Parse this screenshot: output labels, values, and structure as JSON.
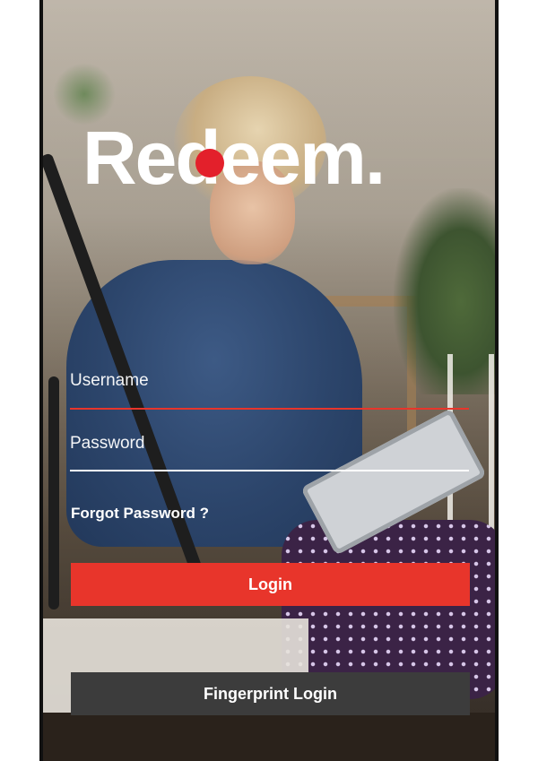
{
  "brand": {
    "logo_part1": "Re",
    "logo_part2": "deem.",
    "accent_color": "#e8352b"
  },
  "form": {
    "username_placeholder": "Username",
    "password_placeholder": "Password",
    "username_underline_color": "#e8352b",
    "password_underline_color": "#ffffff",
    "forgot_password": "Forgot Password ?"
  },
  "buttons": {
    "login": "Login",
    "fingerprint_login": "Fingerprint Login"
  }
}
